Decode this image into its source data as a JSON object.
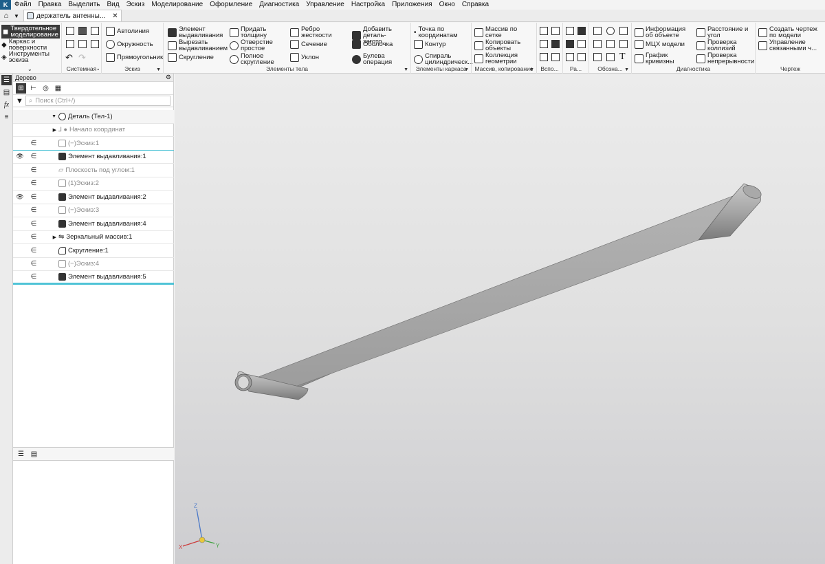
{
  "menu": [
    "Файл",
    "Правка",
    "Выделить",
    "Вид",
    "Эскиз",
    "Моделирование",
    "Оформление",
    "Диагностика",
    "Управление",
    "Настройка",
    "Приложения",
    "Окно",
    "Справка"
  ],
  "document_tab": {
    "title": "держатель антенны..."
  },
  "ribbon": {
    "modes": [
      "Твердотельное моделирование",
      "Каркас и поверхности",
      "Инструменты эскиза"
    ],
    "groups": {
      "system": "Системная",
      "sketch": "Эскиз",
      "body": "Элементы тела",
      "frame": "Элементы каркаса",
      "array": "Массив, копирование",
      "aux": "Вспо...",
      "ra": "Ра...",
      "notation": "Обозна...",
      "diag": "Диагностика",
      "drawing": "Чертеж"
    },
    "sketch_buttons": [
      "Автолиния",
      "Окружность",
      "Прямоугольник"
    ],
    "body_buttons": {
      "extrude": "Элемент\nвыдавливания",
      "cut_extrude": "Вырезать\nвыдавливанием",
      "fillet": "Скругление",
      "thicken": "Придать\nтолщину",
      "hole": "Отверстие\nпростое",
      "full_fillet": "Полное\nскругление",
      "rib": "Ребро\nжесткости",
      "section": "Сечение",
      "draft": "Уклон",
      "add_part": "Добавить\nдеталь-загото...",
      "shell": "Оболочка",
      "boolean": "Булева\nоперация"
    },
    "frame_buttons": {
      "point": "Точка по\nкоординатам",
      "contour": "Контур",
      "spiral": "Спираль\nцилиндрическ..."
    },
    "array_buttons": {
      "grid": "Массив по\nсетке",
      "copy": "Копировать\nобъекты",
      "collection": "Коллекция\nгеометрии"
    },
    "diag_buttons": {
      "info": "Информация\nоб объекте",
      "mch": "МЦХ модели",
      "curvature": "График\nкривизны",
      "distance": "Расстояние и\nугол",
      "collision": "Проверка\nколлизий",
      "continuity": "Проверка\nнепрерывности"
    },
    "drawing_buttons": {
      "create": "Создать чертеж\nпо модели",
      "manage": "Управление\nсвязанными ч..."
    }
  },
  "tree": {
    "title": "Дерево",
    "search_placeholder": "Поиск (Ctrl+/)",
    "items": [
      {
        "label": "Деталь (Тел-1)",
        "vis": "",
        "rel": ""
      },
      {
        "label": "Начало координат",
        "vis": "",
        "rel": ""
      },
      {
        "label": "(−)Эскиз:1",
        "vis": "",
        "rel": "∈"
      },
      {
        "label": "Элемент выдавливания:1",
        "vis": "👁",
        "rel": "∈"
      },
      {
        "label": "Плоскость под углом:1",
        "vis": "",
        "rel": "∈"
      },
      {
        "label": "(1)Эскиз:2",
        "vis": "",
        "rel": "∈"
      },
      {
        "label": "Элемент выдавливания:2",
        "vis": "👁",
        "rel": "∈"
      },
      {
        "label": "(−)Эскиз:3",
        "vis": "",
        "rel": "∈"
      },
      {
        "label": "Элемент выдавливания:4",
        "vis": "",
        "rel": "∈"
      },
      {
        "label": "Зеркальный массив:1",
        "vis": "",
        "rel": "∈"
      },
      {
        "label": "Скругление:1",
        "vis": "",
        "rel": "∈"
      },
      {
        "label": "(−)Эскиз:4",
        "vis": "",
        "rel": "∈"
      },
      {
        "label": "Элемент выдавливания:5",
        "vis": "",
        "rel": "∈"
      }
    ]
  },
  "axes": {
    "x": "X",
    "y": "Y",
    "z": "Z"
  },
  "colors": {
    "accent": "#4fc3d6",
    "model": "#a8a8a8"
  }
}
